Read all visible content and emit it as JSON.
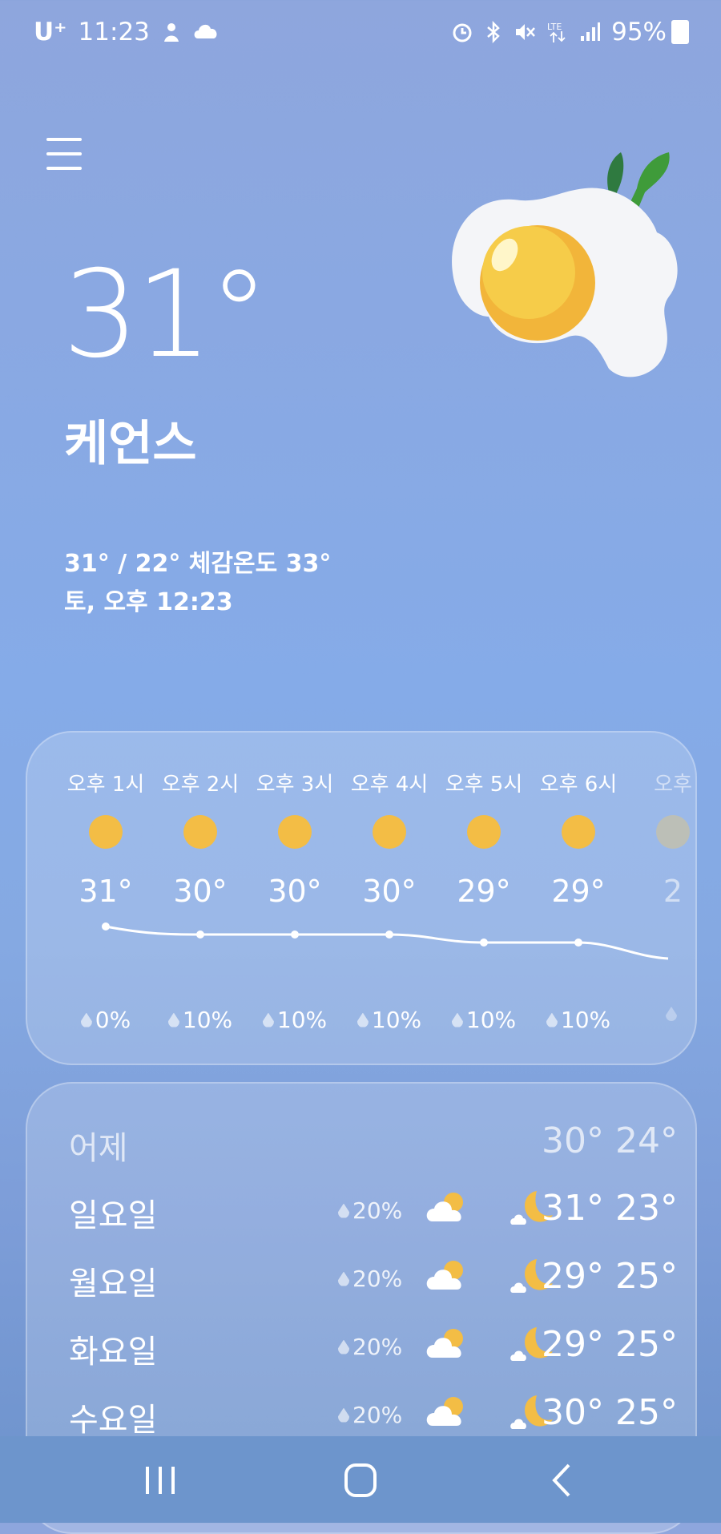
{
  "status_bar": {
    "carrier": "U⁺",
    "time": "11:23",
    "battery": "95%"
  },
  "current": {
    "temperature": "31°",
    "location": "케언스",
    "summary": "31° / 22° 체감온도 33°",
    "datetime": "토, 오후 12:23"
  },
  "hourly": [
    {
      "time": "오후 1시",
      "temp": "31°",
      "rain": "0%"
    },
    {
      "time": "오후 2시",
      "temp": "30°",
      "rain": "10%"
    },
    {
      "time": "오후 3시",
      "temp": "30°",
      "rain": "10%"
    },
    {
      "time": "오후 4시",
      "temp": "30°",
      "rain": "10%"
    },
    {
      "time": "오후 5시",
      "temp": "29°",
      "rain": "10%"
    },
    {
      "time": "오후 6시",
      "temp": "29°",
      "rain": "10%"
    },
    {
      "time": "오후",
      "temp": "2",
      "rain": ""
    }
  ],
  "daily": {
    "yesterday": {
      "name": "어제",
      "temps": "30° 24°"
    },
    "days": [
      {
        "name": "일요일",
        "rain": "20%",
        "temps": "31° 23°"
      },
      {
        "name": "월요일",
        "rain": "20%",
        "temps": "29° 25°"
      },
      {
        "name": "화요일",
        "rain": "20%",
        "temps": "29° 25°"
      },
      {
        "name": "수요일",
        "rain": "20%",
        "temps": "30° 25°"
      }
    ]
  },
  "icons": {
    "menu": "menu-icon",
    "sun": "sun-icon",
    "drop": "rain-drop-icon",
    "partly_cloudy": "partly-cloudy-icon",
    "moon": "cloudy-moon-icon"
  },
  "colors": {
    "sun": "#f3bd45",
    "egg_yolk": "#f2b53a",
    "accent_green": "#3f9b3a"
  }
}
